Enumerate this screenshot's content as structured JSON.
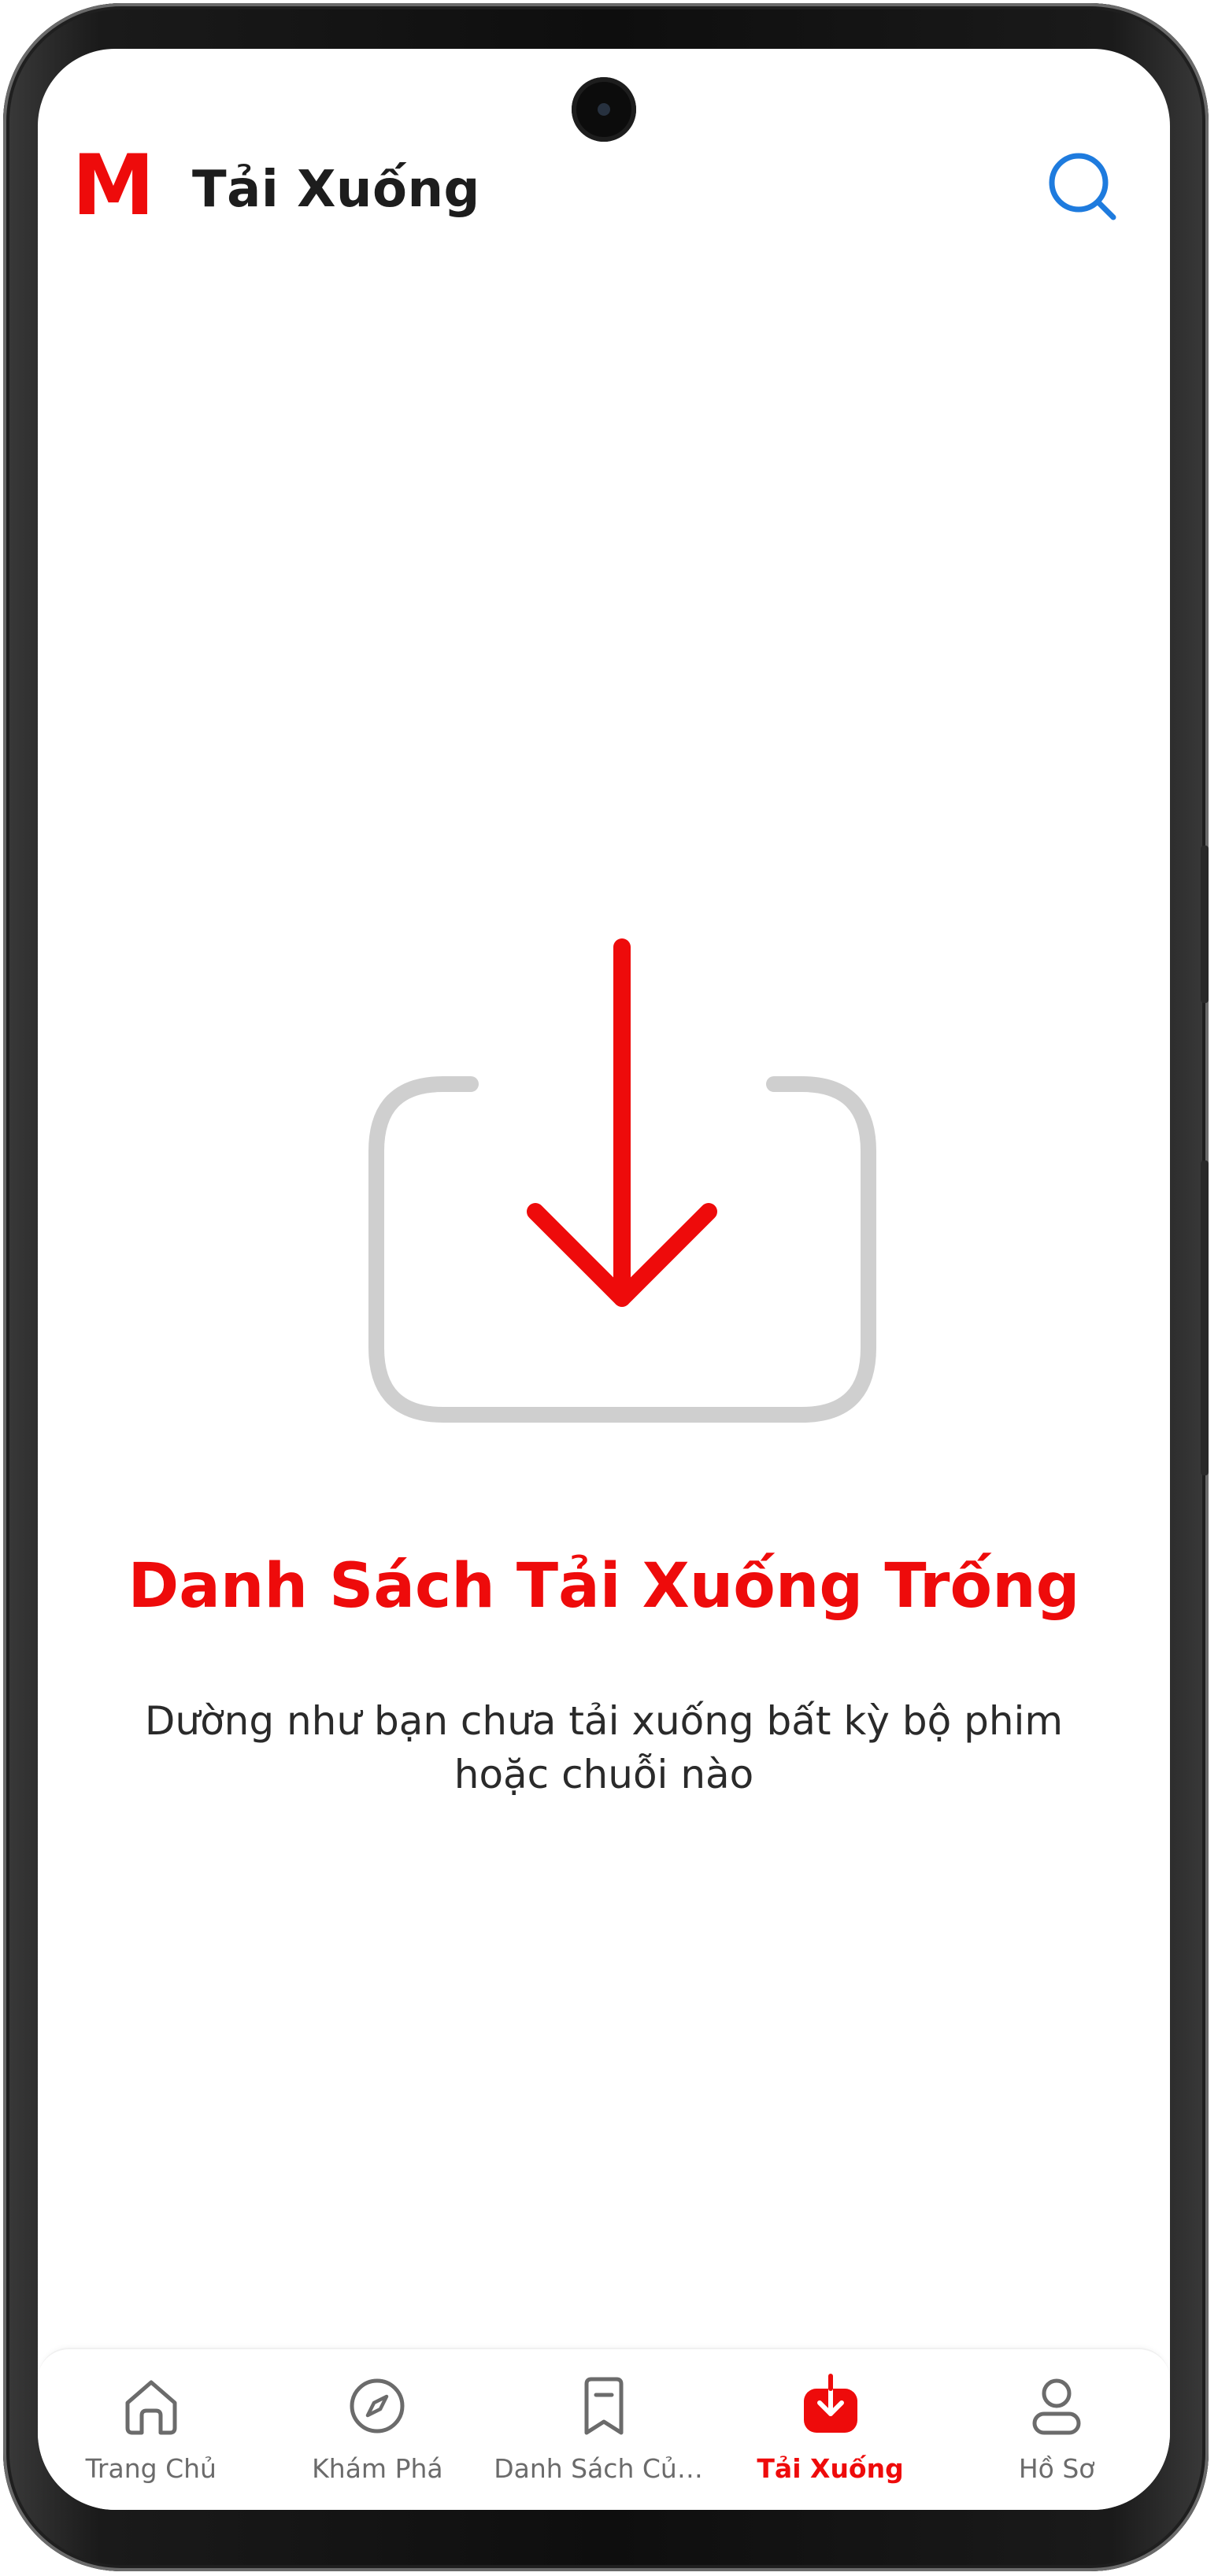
{
  "header": {
    "logo_text": "M",
    "title": "Tải Xuống",
    "search_icon": "search-icon"
  },
  "empty_state": {
    "icon": "download-tray-icon",
    "title": "Danh Sách Tải Xuống Trống",
    "description": "Dường như bạn chưa tải xuống bất kỳ bộ phim hoặc chuỗi nào"
  },
  "bottom_nav": {
    "items": [
      {
        "label": "Trang Chủ",
        "icon": "home-icon",
        "active": false
      },
      {
        "label": "Khám Phá",
        "icon": "compass-icon",
        "active": false
      },
      {
        "label": "Danh Sách Của ...",
        "icon": "bookmark-icon",
        "active": false
      },
      {
        "label": "Tải Xuống",
        "icon": "download-icon",
        "active": true
      },
      {
        "label": "Hồ Sơ",
        "icon": "profile-icon",
        "active": false
      }
    ]
  },
  "colors": {
    "accent": "#ee0b0b",
    "search": "#1e7bde",
    "muted_icon": "#cfcfcf",
    "nav_inactive": "#6b6b6b"
  }
}
